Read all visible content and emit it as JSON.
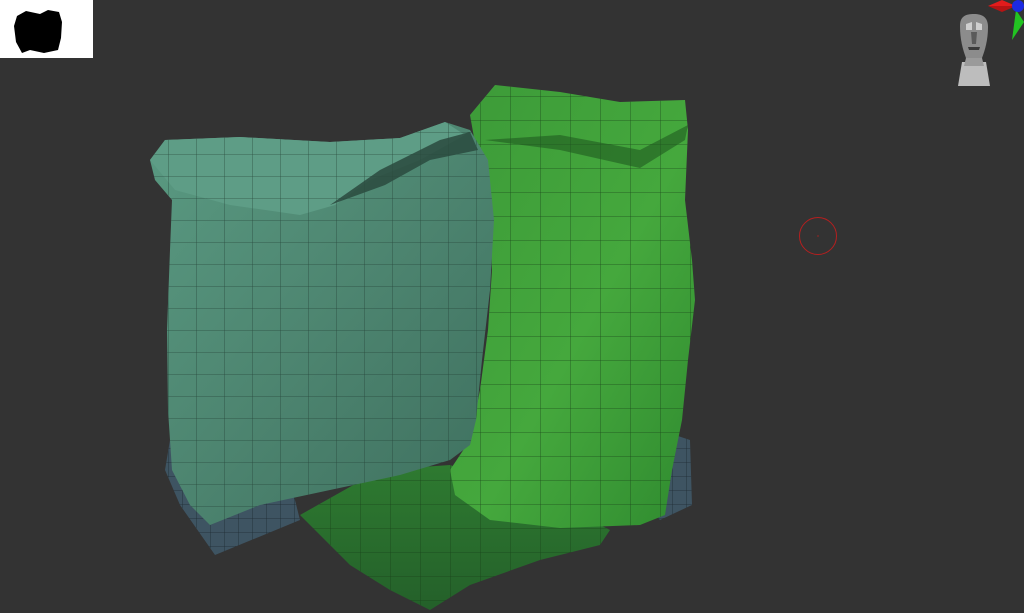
{
  "app": {
    "viewport_background": "#333333"
  },
  "thumbnail": {
    "icon": "mesh-silhouette-icon",
    "background": "#ffffff"
  },
  "navigation_gizmo": {
    "icon": "head-orientation-icon",
    "axes": {
      "x_color": "#e21c1c",
      "y_color": "#22c422",
      "z_color": "#1c2ae2"
    }
  },
  "scene": {
    "objects": [
      {
        "name": "teal-cloth",
        "color": "#4f8a72",
        "state": "front"
      },
      {
        "name": "green-cloth",
        "color": "#3f9a3a",
        "state": "selected"
      },
      {
        "name": "dark-green-cloth",
        "color": "#2d6e30",
        "state": "back"
      },
      {
        "name": "slate-cloth",
        "color": "#3f5562",
        "state": "back"
      }
    ]
  },
  "brush": {
    "icon": "brush-cursor-icon",
    "color": "#b51f1f"
  }
}
